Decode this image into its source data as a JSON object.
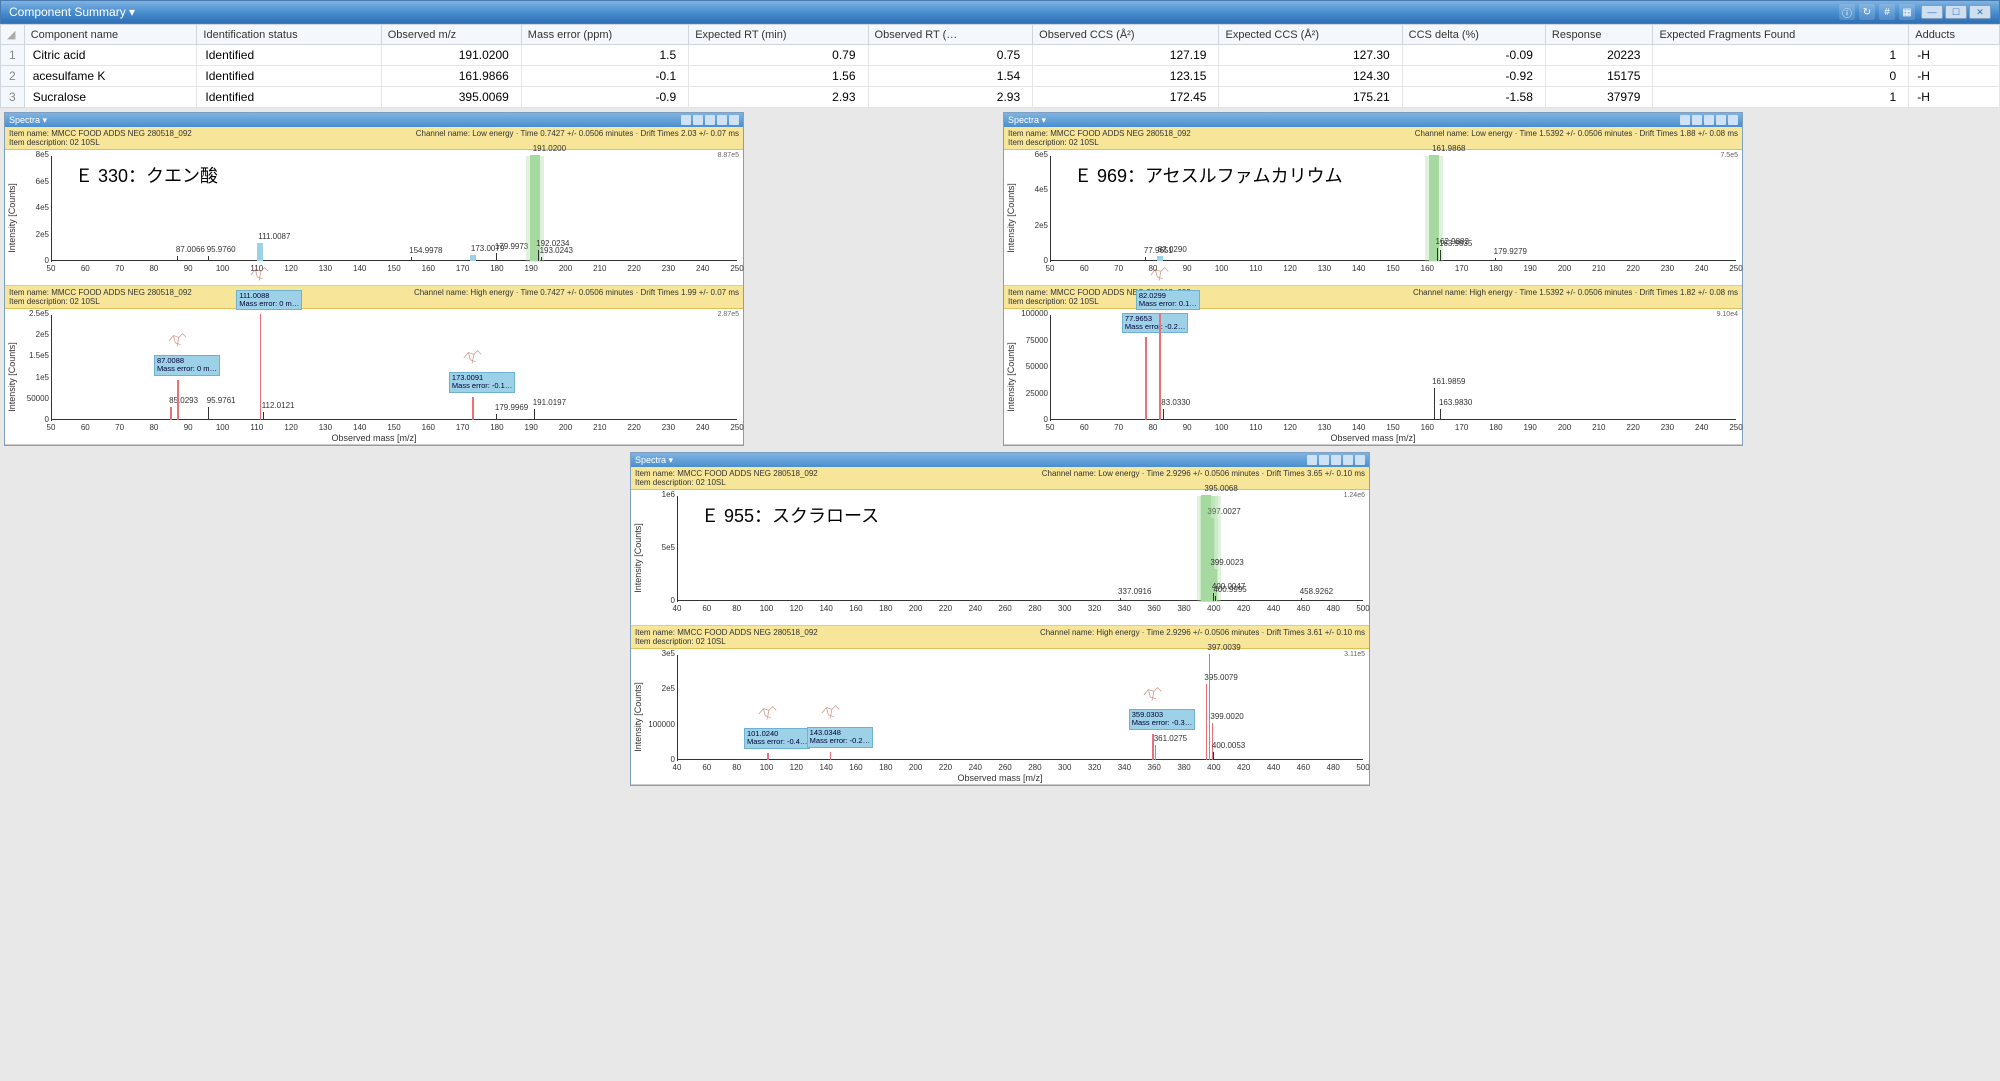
{
  "header": {
    "title": "Component Summary ▾"
  },
  "toolbar_icons": [
    "info-icon",
    "refresh-icon",
    "hash-icon",
    "grid-icon"
  ],
  "columns": [
    "",
    "Component name",
    "Identification status",
    "Observed m/z",
    "Mass error (ppm)",
    "Expected RT (min)",
    "Observed RT (…",
    "Observed CCS (Å²)",
    "Expected CCS (Å²)",
    "CCS delta (%)",
    "Response",
    "Expected Fragments Found",
    "Adducts"
  ],
  "rows": [
    {
      "idx": "1",
      "name": "Citric acid",
      "status": "Identified",
      "obs_mz": "191.0200",
      "merr": "1.5",
      "exp_rt": "0.79",
      "obs_rt": "0.75",
      "obs_ccs": "127.19",
      "exp_ccs": "127.30",
      "ccs_d": "-0.09",
      "resp": "20223",
      "frags": "1",
      "adduct": "-H"
    },
    {
      "idx": "2",
      "name": "acesulfame K",
      "status": "Identified",
      "obs_mz": "161.9866",
      "merr": "-0.1",
      "exp_rt": "1.56",
      "obs_rt": "1.54",
      "obs_ccs": "123.15",
      "exp_ccs": "124.30",
      "ccs_d": "-0.92",
      "resp": "15175",
      "frags": "0",
      "adduct": "-H"
    },
    {
      "idx": "3",
      "name": "Sucralose",
      "status": "Identified",
      "obs_mz": "395.0069",
      "merr": "-0.9",
      "exp_rt": "2.93",
      "obs_rt": "2.93",
      "obs_ccs": "172.45",
      "exp_ccs": "175.21",
      "ccs_d": "-1.58",
      "resp": "37979",
      "frags": "1",
      "adduct": "-H"
    }
  ],
  "spectra_common": {
    "channel_low_prefix": "Channel name: Low energy · Time ",
    "channel_high_prefix": "Channel name: High energy · Time ",
    "item_line1": "Item name: MMCC FOOD ADDS NEG 280518_092",
    "item_line2": "Item description: 02 10SL",
    "ylabel": "Intensity [Counts]",
    "xlabel": "Observed mass [m/z]",
    "tab_title": "Spectra ▾"
  },
  "panels": [
    {
      "caption": "Ｅ 330：クエン酸",
      "xrange": [
        50,
        250
      ],
      "low": {
        "channel_suffix": "0.7427 +/- 0.0506 minutes · Drift Times 2.03 +/- 0.07 ms",
        "ymax": "8e5",
        "corner": "8.87e5",
        "yticks": [
          "0",
          "2e5",
          "4e5",
          "6e5",
          "8e5"
        ],
        "peaks": [
          {
            "mz": 87.0066,
            "h": 0.05,
            "lbl": "87.0066"
          },
          {
            "mz": 95.976,
            "h": 0.05,
            "lbl": "95.9760"
          },
          {
            "mz": 111.0087,
            "h": 0.17,
            "lbl": "111.0087",
            "blue": true
          },
          {
            "mz": 154.9978,
            "h": 0.04,
            "lbl": "154.9978"
          },
          {
            "mz": 173.0079,
            "h": 0.06,
            "lbl": "173.0079",
            "blue": true
          },
          {
            "mz": 179.9973,
            "h": 0.08,
            "lbl": "179.9973"
          },
          {
            "mz": 191.02,
            "h": 1.0,
            "lbl": "191.0200",
            "green": true
          },
          {
            "mz": 192.0234,
            "h": 0.1,
            "lbl": "192.0234"
          },
          {
            "mz": 193.0243,
            "h": 0.04,
            "lbl": "193.0243"
          }
        ]
      },
      "high": {
        "channel_suffix": "0.7427 +/- 0.0506 minutes · Drift Times 1.99 +/- 0.07 ms",
        "ymax": "2.5e5",
        "corner": "2.87e5",
        "yticks": [
          "0",
          "50000",
          "1e5",
          "1.5e5",
          "2e5",
          "2.5e5"
        ],
        "peaks": [
          {
            "mz": 85.0293,
            "h": 0.12,
            "lbl": "85.0293",
            "red": true
          },
          {
            "mz": 87.0088,
            "h": 0.38,
            "lbl": "",
            "frag": "87.0088\nMass error: 0 m…",
            "red": true,
            "struct": true
          },
          {
            "mz": 95.9761,
            "h": 0.12,
            "lbl": "95.9761"
          },
          {
            "mz": 111.0088,
            "h": 1.0,
            "lbl": "",
            "frag": "111.0088\nMass error: 0 m…",
            "red": true,
            "struct": true
          },
          {
            "mz": 112.0121,
            "h": 0.08,
            "lbl": "112.0121"
          },
          {
            "mz": 173.0091,
            "h": 0.22,
            "lbl": "",
            "frag": "173.0091\nMass error: -0.1…",
            "red": true,
            "struct": true
          },
          {
            "mz": 179.9969,
            "h": 0.06,
            "lbl": "179.9969"
          },
          {
            "mz": 191.0197,
            "h": 0.1,
            "lbl": "191.0197"
          }
        ]
      }
    },
    {
      "caption": "Ｅ 969：アセスルファムカリウム",
      "xrange": [
        50,
        250
      ],
      "low": {
        "channel_suffix": "1.5392 +/- 0.0506 minutes · Drift Times 1.88 +/- 0.08 ms",
        "ymax": "6e5",
        "corner": "7.5e5",
        "yticks": [
          "0",
          "2e5",
          "4e5",
          "6e5"
        ],
        "peaks": [
          {
            "mz": 77.9651,
            "h": 0.04,
            "lbl": "77.9651"
          },
          {
            "mz": 82.029,
            "h": 0.05,
            "lbl": "82.0290",
            "blue": true
          },
          {
            "mz": 161.9868,
            "h": 1.0,
            "lbl": "161.9868",
            "green": true
          },
          {
            "mz": 162.9882,
            "h": 0.12,
            "lbl": "162.9882"
          },
          {
            "mz": 163.9835,
            "h": 0.1,
            "lbl": "163.9835"
          },
          {
            "mz": 179.9279,
            "h": 0.03,
            "lbl": "179.9279"
          }
        ]
      },
      "high": {
        "channel_suffix": "1.5392 +/- 0.0506 minutes · Drift Times 1.82 +/- 0.08 ms",
        "ymax": "100000",
        "corner": "9.10e4",
        "yticks": [
          "0",
          "25000",
          "50000",
          "75000",
          "100000"
        ],
        "peaks": [
          {
            "mz": 77.9653,
            "h": 0.78,
            "lbl": "",
            "frag": "77.9653\nMass error: -0.2…",
            "red": true,
            "struct": true
          },
          {
            "mz": 82.0299,
            "h": 1.0,
            "lbl": "",
            "frag": "82.0299\nMass error: 0.1…",
            "red": true,
            "struct": true
          },
          {
            "mz": 83.033,
            "h": 0.1,
            "lbl": "83.0330"
          },
          {
            "mz": 161.9859,
            "h": 0.3,
            "lbl": "161.9859"
          },
          {
            "mz": 163.983,
            "h": 0.1,
            "lbl": "163.9830"
          }
        ]
      }
    },
    {
      "caption": "Ｅ 955：スクラロース",
      "xrange": [
        40,
        500
      ],
      "low": {
        "channel_suffix": "2.9296 +/- 0.0506 minutes · Drift Times 3.65 +/- 0.10 ms",
        "ymax": "1e6",
        "corner": "1.24e6",
        "yticks": [
          "0",
          "5e5",
          "1e6"
        ],
        "peaks": [
          {
            "mz": 337.0916,
            "h": 0.03,
            "lbl": "337.0916"
          },
          {
            "mz": 395.0068,
            "h": 1.0,
            "lbl": "395.0068",
            "green": true
          },
          {
            "mz": 397.0027,
            "h": 0.78,
            "lbl": "397.0027",
            "green": true
          },
          {
            "mz": 399.0023,
            "h": 0.3,
            "lbl": "399.0023",
            "green": true
          },
          {
            "mz": 400.0047,
            "h": 0.08,
            "lbl": "400.0047"
          },
          {
            "mz": 400.9995,
            "h": 0.05,
            "lbl": "400.9995"
          },
          {
            "mz": 458.9262,
            "h": 0.03,
            "lbl": "458.9262"
          }
        ]
      },
      "high": {
        "channel_suffix": "2.9296 +/- 0.0506 minutes · Drift Times 3.61 +/- 0.10 ms",
        "ymax": "3e5",
        "corner": "3.11e5",
        "yticks": [
          "0",
          "100000",
          "2e5",
          "3e5"
        ],
        "peaks": [
          {
            "mz": 101.024,
            "h": 0.07,
            "lbl": "",
            "frag": "101.0240\nMass error: -0.4…",
            "red": true,
            "struct": true
          },
          {
            "mz": 143.0348,
            "h": 0.08,
            "lbl": "",
            "frag": "143.0348\nMass error: -0.2…",
            "red": true,
            "struct": true
          },
          {
            "mz": 359.0303,
            "h": 0.25,
            "lbl": "",
            "frag": "359.0303\nMass error: -0.3…",
            "red": true,
            "struct": true
          },
          {
            "mz": 361.0275,
            "h": 0.14,
            "lbl": "361.0275",
            "red": true
          },
          {
            "mz": 395.0079,
            "h": 0.72,
            "lbl": "395.0079",
            "red": true
          },
          {
            "mz": 397.0039,
            "h": 1.0,
            "lbl": "397.0039",
            "red": true
          },
          {
            "mz": 399.002,
            "h": 0.35,
            "lbl": "399.0020",
            "red": true
          },
          {
            "mz": 400.0053,
            "h": 0.08,
            "lbl": "400.0053"
          }
        ]
      }
    }
  ]
}
